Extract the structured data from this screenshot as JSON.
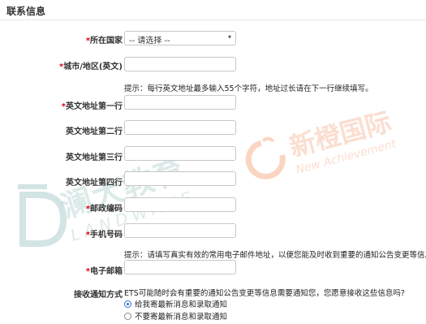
{
  "section": {
    "title": "联系信息"
  },
  "fields": {
    "country": {
      "label": "所在国家",
      "required": "*",
      "value": "-- 请选择 --"
    },
    "city": {
      "label": "城市/地区(英文)",
      "required": "*"
    },
    "hint1": "提示：每行英文地址最多输入55个字符，地址过长请在下一行继续填写。",
    "addr1": {
      "label": "英文地址第一行",
      "required": "*"
    },
    "addr2": {
      "label": "英文地址第二行"
    },
    "addr3": {
      "label": "英文地址第三行"
    },
    "addr4": {
      "label": "英文地址第四行"
    },
    "postal": {
      "label": "邮政编码",
      "required": "*"
    },
    "phone": {
      "label": "手机号码",
      "required": "*"
    },
    "hint2": "提示：请填写真实有效的常用电子邮件地址，以便您能及时收到重要的通知公告变更等信息。",
    "email": {
      "label": "电子邮箱",
      "required": "*"
    }
  },
  "notification": {
    "label": "接收通知方式",
    "question": "ETS可能随时会有重要的通知公告变更等信息需要通知您，您愿意接收这些信息吗?",
    "options": [
      "给我寄最新消息和录取通知",
      "不要寄最新消息和录取通知"
    ],
    "selected_index": 0
  },
  "watermarks": {
    "left_cn": "澜大教育",
    "left_en": "LANDWAVE",
    "right_cn": "新橙国际",
    "right_en": "New Achievement"
  }
}
